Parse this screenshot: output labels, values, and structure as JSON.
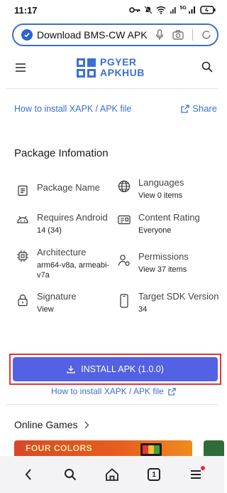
{
  "status": {
    "time": "11:17",
    "signal_label": "5G"
  },
  "browser": {
    "url_text": "Download BMS-CW APK fo",
    "tab_count": "1"
  },
  "site": {
    "logo_line1": "PGYER",
    "logo_line2": "APKHUB"
  },
  "links": {
    "howto_top": "How to install XAPK / APK file",
    "share": "Share",
    "howto_bottom": "How to install XAPK / APK file"
  },
  "package": {
    "title": "Package Infomation",
    "items": [
      {
        "label": "Package Name",
        "value": "",
        "icon": "document-icon"
      },
      {
        "label": "Languages",
        "value": "View 0 items",
        "icon": "globe-icon"
      },
      {
        "label": "Requires Android",
        "value": "14 (34)",
        "icon": "android-icon"
      },
      {
        "label": "Content Rating",
        "value": "Everyone",
        "icon": "id-card-icon"
      },
      {
        "label": "Architecture",
        "value": "arm64-v8a, armeabi-v7a",
        "icon": "chip-icon"
      },
      {
        "label": "Permissions",
        "value": "View 37 items",
        "icon": "user-settings-icon"
      },
      {
        "label": "Signature",
        "value": "View",
        "icon": "lock-icon"
      },
      {
        "label": "Target SDK Version",
        "value": "34",
        "icon": "phone-icon"
      }
    ]
  },
  "install": {
    "label": "INSTALL APK (1.0.0)"
  },
  "games": {
    "title": "Online Games",
    "card1_text": "FOUR COLORS"
  },
  "colors": {
    "accent": "#3c6fd6",
    "install_button": "#5361e3",
    "highlight_border": "#e0353c"
  }
}
